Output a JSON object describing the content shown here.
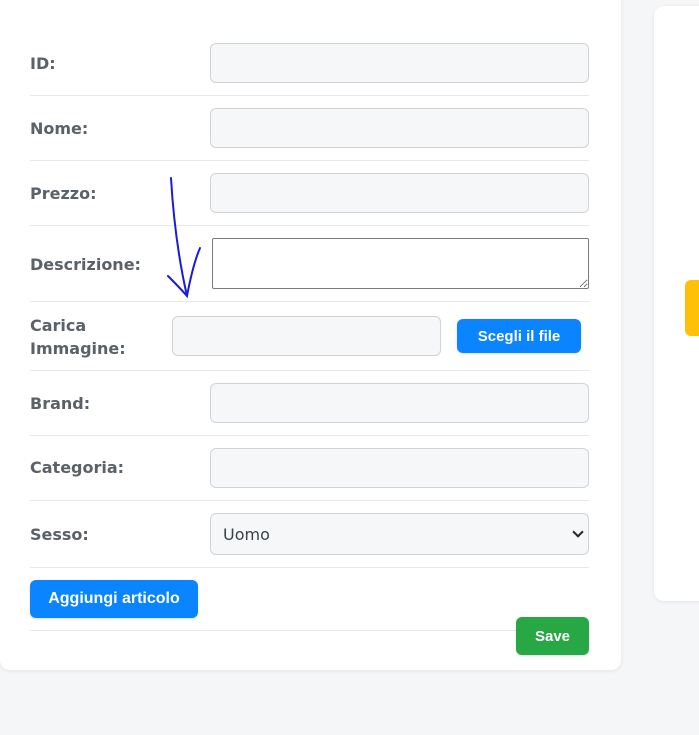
{
  "form": {
    "id_label": "ID:",
    "name_label": "Nome:",
    "price_label": "Prezzo:",
    "description_label": "Descrizione:",
    "image_label_line1": "Carica",
    "image_label_line2": "Immagine:",
    "choose_file_label": "Scegli il file",
    "brand_label": "Brand:",
    "category_label": "Categoria:",
    "gender_label": "Sesso:",
    "gender_selected": "Uomo",
    "add_item_label": "Aggiungi articolo",
    "save_label": "Save"
  },
  "colors": {
    "primary": "#0a84ff",
    "success": "#28a745",
    "warning": "#ffc107",
    "annotation": "#1a1adb"
  }
}
